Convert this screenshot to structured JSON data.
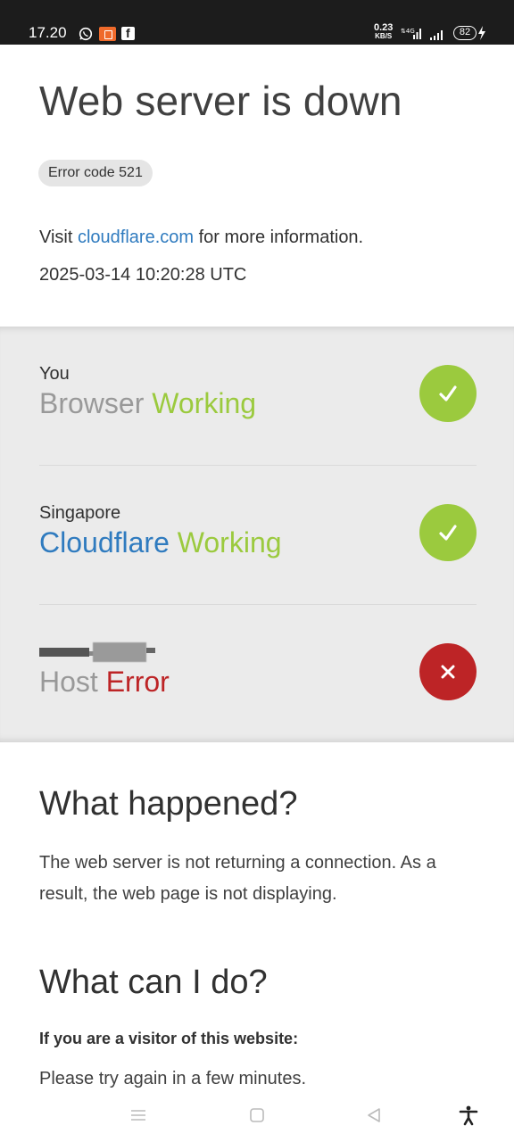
{
  "status_bar": {
    "time": "17.20",
    "net_speed_value": "0.23",
    "net_speed_unit": "KB/S",
    "battery": "82"
  },
  "header": {
    "title": "Web server is down",
    "error_badge": "Error code 521",
    "info_prefix": "Visit ",
    "info_link": "cloudflare.com",
    "info_suffix": " for more information.",
    "timestamp": "2025-03-14 10:20:28 UTC"
  },
  "status_rows": [
    {
      "place": "You",
      "label": "Browser",
      "state": "Working",
      "status": "ok",
      "icon": "check-icon"
    },
    {
      "place": "Singapore",
      "label": "Cloudflare",
      "state": "Working",
      "status": "ok",
      "icon": "check-icon"
    },
    {
      "place": "",
      "label": "Host",
      "state": "Error",
      "status": "error",
      "icon": "cross-icon"
    }
  ],
  "what_happened": {
    "heading": "What happened?",
    "body": "The web server is not returning a connection. As a result, the web page is not displaying."
  },
  "what_can_i_do": {
    "heading": "What can I do?",
    "visitor_heading": "If you are a visitor of this website:",
    "visitor_text": "Please try again in a few minutes."
  },
  "colors": {
    "green": "#9bca3e",
    "red": "#bd2426",
    "link_blue": "#2f7bbf",
    "panel_gray": "#ebebeb"
  },
  "nav_icons": [
    "menu-icon",
    "home-icon",
    "back-icon",
    "accessibility-icon"
  ]
}
